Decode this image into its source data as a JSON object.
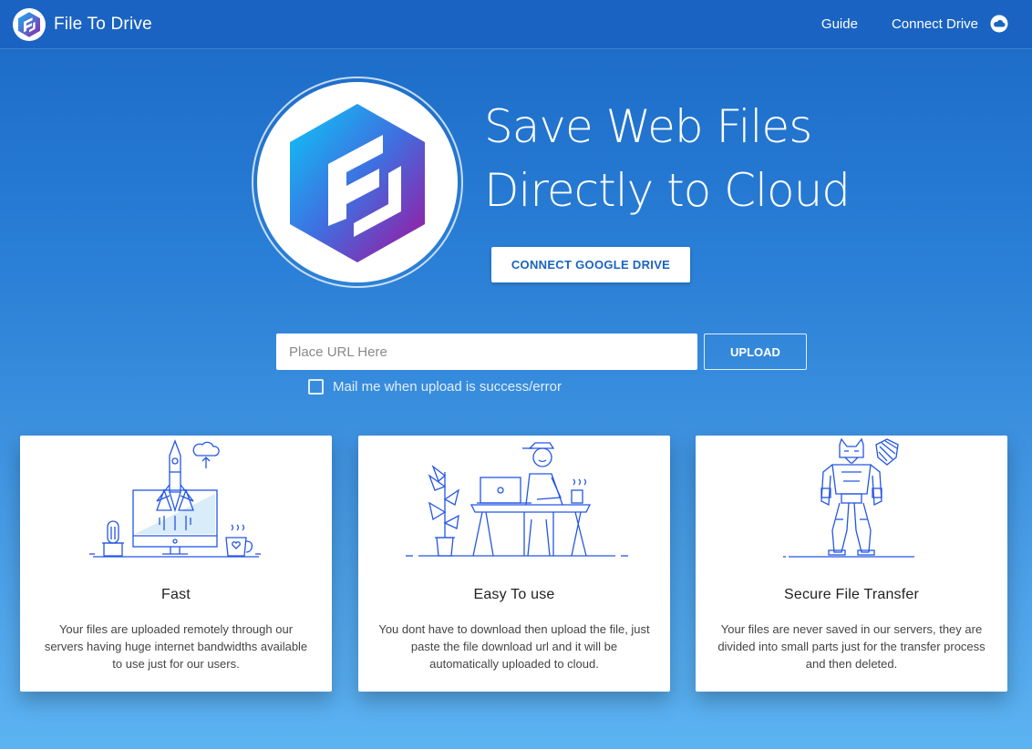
{
  "app": {
    "title": "File To Drive"
  },
  "nav": {
    "guide": "Guide",
    "connect_drive": "Connect Drive"
  },
  "hero": {
    "title_line1": "Save Web Files",
    "title_line2": "Directly to Cloud",
    "connect_button": "CONNECT GOOGLE DRIVE"
  },
  "upload": {
    "placeholder": "Place URL Here",
    "value": "",
    "button": "UPLOAD",
    "mail_label": "Mail me when upload is success/error",
    "mail_checked": false
  },
  "features": [
    {
      "title": "Fast",
      "text": "Your files are uploaded remotely through our servers having huge internet bandwidths available to use just for our users.",
      "icon": "rocket-launch-illustration"
    },
    {
      "title": "Easy To use",
      "text": "You dont have to download then upload the file, just paste the file download url and it will be automatically uploaded to cloud.",
      "icon": "person-at-desk-illustration"
    },
    {
      "title": "Secure File Transfer",
      "text": "Your files are never saved in our servers, they are divided into small parts just for the transfer process and then deleted.",
      "icon": "robot-shield-illustration"
    }
  ],
  "colors": {
    "primary": "#1a63c2",
    "accent_purple": "#8e24aa",
    "accent_cyan": "#1ab3f0",
    "line_art": "#2456e6"
  }
}
